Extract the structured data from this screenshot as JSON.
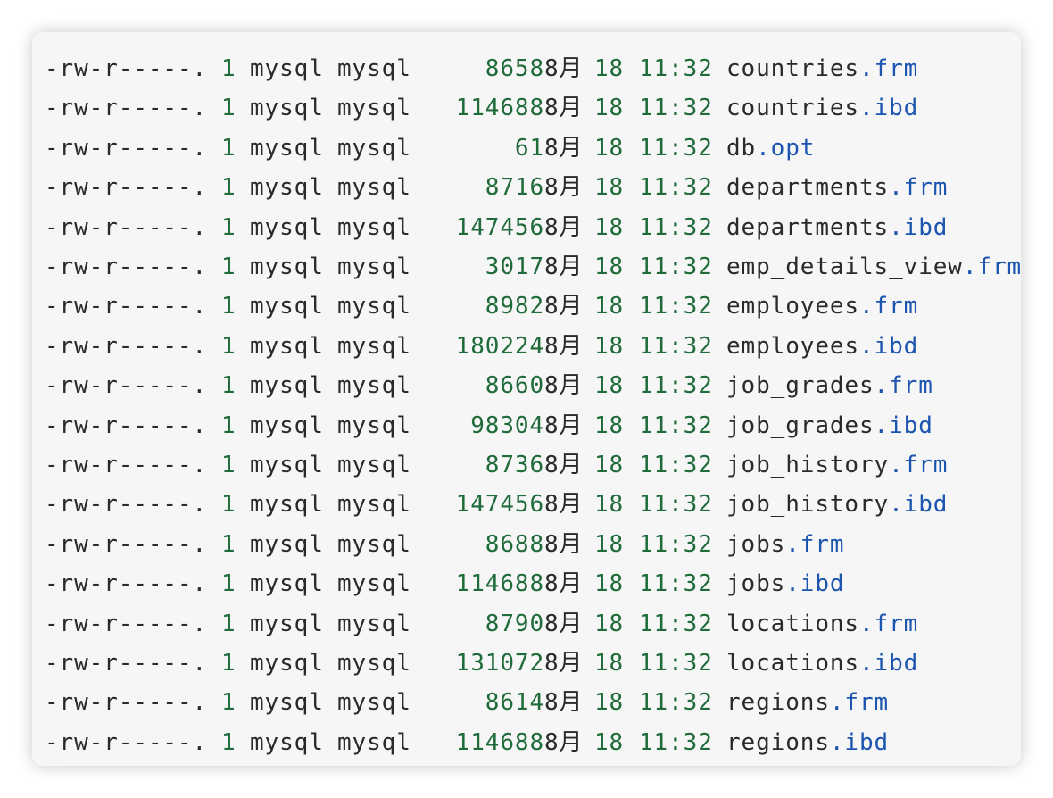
{
  "files": [
    {
      "perms": "-rw-r-----.",
      "links": "1",
      "owner": "mysql",
      "group": "mysql",
      "size": "8658",
      "month": "8月",
      "day": "18",
      "time": "11:32",
      "base": "countries",
      "ext": ".frm"
    },
    {
      "perms": "-rw-r-----.",
      "links": "1",
      "owner": "mysql",
      "group": "mysql",
      "size": "114688",
      "month": "8月",
      "day": "18",
      "time": "11:32",
      "base": "countries",
      "ext": ".ibd"
    },
    {
      "perms": "-rw-r-----.",
      "links": "1",
      "owner": "mysql",
      "group": "mysql",
      "size": "61",
      "month": "8月",
      "day": "18",
      "time": "11:32",
      "base": "db",
      "ext": ".opt"
    },
    {
      "perms": "-rw-r-----.",
      "links": "1",
      "owner": "mysql",
      "group": "mysql",
      "size": "8716",
      "month": "8月",
      "day": "18",
      "time": "11:32",
      "base": "departments",
      "ext": ".frm"
    },
    {
      "perms": "-rw-r-----.",
      "links": "1",
      "owner": "mysql",
      "group": "mysql",
      "size": "147456",
      "month": "8月",
      "day": "18",
      "time": "11:32",
      "base": "departments",
      "ext": ".ibd"
    },
    {
      "perms": "-rw-r-----.",
      "links": "1",
      "owner": "mysql",
      "group": "mysql",
      "size": "3017",
      "month": "8月",
      "day": "18",
      "time": "11:32",
      "base": "emp_details_view",
      "ext": ".frm"
    },
    {
      "perms": "-rw-r-----.",
      "links": "1",
      "owner": "mysql",
      "group": "mysql",
      "size": "8982",
      "month": "8月",
      "day": "18",
      "time": "11:32",
      "base": "employees",
      "ext": ".frm"
    },
    {
      "perms": "-rw-r-----.",
      "links": "1",
      "owner": "mysql",
      "group": "mysql",
      "size": "180224",
      "month": "8月",
      "day": "18",
      "time": "11:32",
      "base": "employees",
      "ext": ".ibd"
    },
    {
      "perms": "-rw-r-----.",
      "links": "1",
      "owner": "mysql",
      "group": "mysql",
      "size": "8660",
      "month": "8月",
      "day": "18",
      "time": "11:32",
      "base": "job_grades",
      "ext": ".frm"
    },
    {
      "perms": "-rw-r-----.",
      "links": "1",
      "owner": "mysql",
      "group": "mysql",
      "size": "98304",
      "month": "8月",
      "day": "18",
      "time": "11:32",
      "base": "job_grades",
      "ext": ".ibd"
    },
    {
      "perms": "-rw-r-----.",
      "links": "1",
      "owner": "mysql",
      "group": "mysql",
      "size": "8736",
      "month": "8月",
      "day": "18",
      "time": "11:32",
      "base": "job_history",
      "ext": ".frm"
    },
    {
      "perms": "-rw-r-----.",
      "links": "1",
      "owner": "mysql",
      "group": "mysql",
      "size": "147456",
      "month": "8月",
      "day": "18",
      "time": "11:32",
      "base": "job_history",
      "ext": ".ibd"
    },
    {
      "perms": "-rw-r-----.",
      "links": "1",
      "owner": "mysql",
      "group": "mysql",
      "size": "8688",
      "month": "8月",
      "day": "18",
      "time": "11:32",
      "base": "jobs",
      "ext": ".frm"
    },
    {
      "perms": "-rw-r-----.",
      "links": "1",
      "owner": "mysql",
      "group": "mysql",
      "size": "114688",
      "month": "8月",
      "day": "18",
      "time": "11:32",
      "base": "jobs",
      "ext": ".ibd"
    },
    {
      "perms": "-rw-r-----.",
      "links": "1",
      "owner": "mysql",
      "group": "mysql",
      "size": "8790",
      "month": "8月",
      "day": "18",
      "time": "11:32",
      "base": "locations",
      "ext": ".frm"
    },
    {
      "perms": "-rw-r-----.",
      "links": "1",
      "owner": "mysql",
      "group": "mysql",
      "size": "131072",
      "month": "8月",
      "day": "18",
      "time": "11:32",
      "base": "locations",
      "ext": ".ibd"
    },
    {
      "perms": "-rw-r-----.",
      "links": "1",
      "owner": "mysql",
      "group": "mysql",
      "size": "8614",
      "month": "8月",
      "day": "18",
      "time": "11:32",
      "base": "regions",
      "ext": ".frm"
    },
    {
      "perms": "-rw-r-----.",
      "links": "1",
      "owner": "mysql",
      "group": "mysql",
      "size": "114688",
      "month": "8月",
      "day": "18",
      "time": "11:32",
      "base": "regions",
      "ext": ".ibd"
    }
  ]
}
